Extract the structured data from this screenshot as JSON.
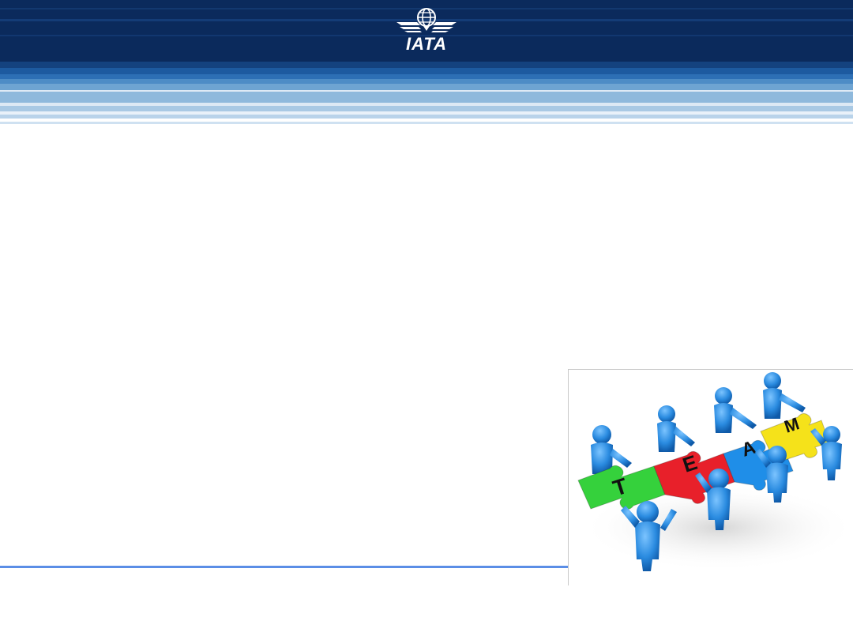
{
  "header": {
    "logo_text": "IATA",
    "colors": {
      "navy": "#0b2a5c",
      "mid_blue": "#1f5da8",
      "light_blue": "#8fb9dc",
      "pale_blue": "#cfe1f1"
    }
  },
  "slide": {
    "rule_color": "#5b8ee6"
  },
  "team_picture": {
    "letters": [
      "T",
      "E",
      "A",
      "M"
    ],
    "piece_colors": [
      "#35d13c",
      "#e8202a",
      "#1f8ee8",
      "#f5e21a"
    ],
    "figure_color": "#2a8be0",
    "icon": "team-puzzle-illustration"
  }
}
